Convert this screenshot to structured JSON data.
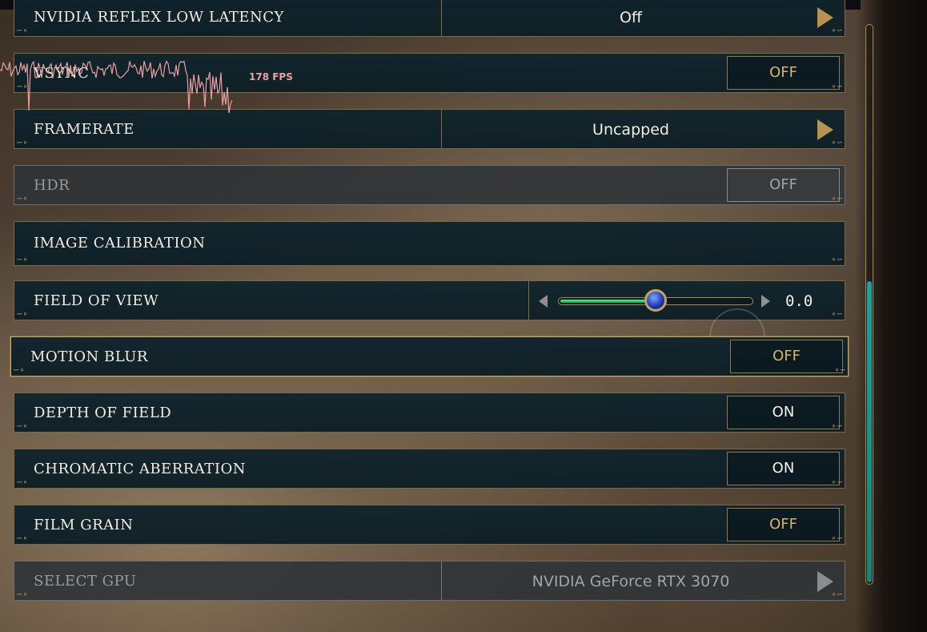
{
  "colors": {
    "accent_gold": "#c9a65a",
    "off_text": "#d7b46a",
    "on_text": "#f4f1ea",
    "slider_fill": "#2ed27a",
    "scroll_thumb": "#1aa3a3"
  },
  "overlay": {
    "fps_label": "178 FPS"
  },
  "settings": {
    "reflex": {
      "label": "NVIDIA REFLEX LOW LATENCY",
      "value": "Off"
    },
    "vsync": {
      "label": "VSYNC",
      "value": "OFF"
    },
    "framerate": {
      "label": "FRAMERATE",
      "value": "Uncapped"
    },
    "hdr": {
      "label": "HDR",
      "value": "OFF",
      "disabled": true
    },
    "image_calibration": {
      "label": "IMAGE CALIBRATION"
    },
    "fov": {
      "label": "FIELD OF VIEW",
      "value": "0.0",
      "fill_fraction": 0.5
    },
    "motion_blur": {
      "label": "MOTION BLUR",
      "value": "OFF",
      "focused": true
    },
    "depth_of_field": {
      "label": "DEPTH OF FIELD",
      "value": "ON"
    },
    "chromatic_aberration": {
      "label": "CHROMATIC ABERRATION",
      "value": "ON"
    },
    "film_grain": {
      "label": "FILM GRAIN",
      "value": "OFF"
    },
    "select_gpu": {
      "label": "SELECT GPU",
      "value": "NVIDIA GeForce RTX 3070",
      "disabled": true
    }
  },
  "scrollbar": {
    "thumb_start_fraction": 0.46,
    "thumb_end_fraction": 1.0
  },
  "icons": {
    "select_arrow": "chevron-right-icon",
    "slider_left": "arrow-left-icon",
    "slider_right": "arrow-right-icon",
    "slider_knob": "sapphire-knob-icon"
  }
}
